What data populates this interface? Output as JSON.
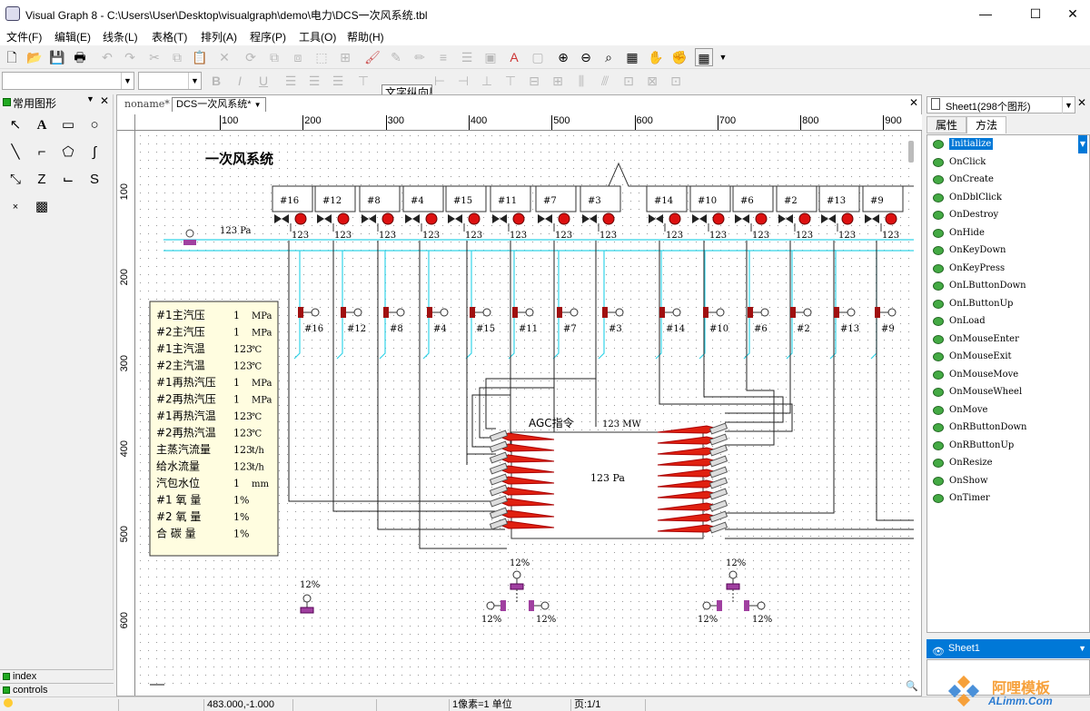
{
  "window": {
    "title": "Visual Graph 8 - C:\\Users\\User\\Desktop\\visualgraph\\demo\\电力\\DCS一次风系统.tbl",
    "min": "—",
    "max": "☐",
    "close": "✕"
  },
  "menu": [
    "文件(F)",
    "编辑(E)",
    "线条(L)",
    "表格(T)",
    "排列(A)",
    "程序(P)",
    "工具(O)",
    "帮助(H)"
  ],
  "tooltip": "文字纵向居",
  "left_panel": {
    "title": "常用图形",
    "close": "✕",
    "foot": [
      "index",
      "controls"
    ]
  },
  "doc": {
    "tabs": [
      "noname*",
      "DCS一次风系统*"
    ],
    "tab_arrow": "▼",
    "close": "✕",
    "hruler": [
      "100",
      "200",
      "300",
      "400",
      "500",
      "600",
      "700",
      "800",
      "900"
    ],
    "vruler": [
      "100",
      "200",
      "300",
      "400",
      "500",
      "600"
    ],
    "title": "一次风系统",
    "pressure_label": "123 Pa",
    "burners_left": [
      "#16",
      "#12",
      "#8",
      "#4",
      "#15",
      "#11",
      "#7",
      "#3"
    ],
    "burners_right": [
      "#14",
      "#10",
      "#6",
      "#2",
      "#13",
      "#9"
    ],
    "burner_value": "123",
    "valves_left": [
      "#16",
      "#12",
      "#8",
      "#4",
      "#15",
      "#11",
      "#7",
      "#3"
    ],
    "valves_right": [
      "#14",
      "#10",
      "#6",
      "#2",
      "#13",
      "#9"
    ],
    "params": [
      {
        "name": "#1主汽压",
        "val": "1",
        "unit": "MPa"
      },
      {
        "name": "#2主汽压",
        "val": "1",
        "unit": "MPa"
      },
      {
        "name": "#1主汽温",
        "val": "123",
        "unit": "℃"
      },
      {
        "name": "#2主汽温",
        "val": "123",
        "unit": "℃"
      },
      {
        "name": "#1再热汽压",
        "val": "1",
        "unit": "MPa"
      },
      {
        "name": "#2再热汽压",
        "val": "1",
        "unit": "MPa"
      },
      {
        "name": "#1再热汽温",
        "val": "123",
        "unit": "℃"
      },
      {
        "name": "#2再热汽温",
        "val": "123",
        "unit": "℃"
      },
      {
        "name": "主蒸汽流量",
        "val": "123",
        "unit": "t/h"
      },
      {
        "name": "给水流量",
        "val": "123",
        "unit": "t/h"
      },
      {
        "name": "汽包水位",
        "val": "1",
        "unit": "mm"
      },
      {
        "name": "#1 氧 量",
        "val": "1%",
        "unit": ""
      },
      {
        "name": "#2 氧 量",
        "val": "1%",
        "unit": ""
      },
      {
        "name": "合 碳 量",
        "val": "1%",
        "unit": ""
      }
    ],
    "agc_label": "AGC指令",
    "agc_value": "123 MW",
    "furnace_value": "123 Pa",
    "damper_pct": "12%"
  },
  "right_panel": {
    "sheet_combo": "Sheet1(298个图形)",
    "tabs": [
      "属性",
      "方法"
    ],
    "close": "✕",
    "methods": [
      "Initialize",
      "OnClick",
      "OnCreate",
      "OnDblClick",
      "OnDestroy",
      "OnHide",
      "OnKeyDown",
      "OnKeyPress",
      "OnLButtonDown",
      "OnLButtonUp",
      "OnLoad",
      "OnMouseEnter",
      "OnMouseExit",
      "OnMouseMove",
      "OnMouseWheel",
      "OnMove",
      "OnRButtonDown",
      "OnRButtonUp",
      "OnResize",
      "OnShow",
      "OnTimer"
    ],
    "sheet_item": "Sheet1"
  },
  "status": {
    "coords": "483.000,-1.000",
    "unit": "1像素=1 单位",
    "page": "页:1/1"
  },
  "watermark": {
    "name": "阿哩模板",
    "url": "ALimm.Com"
  }
}
